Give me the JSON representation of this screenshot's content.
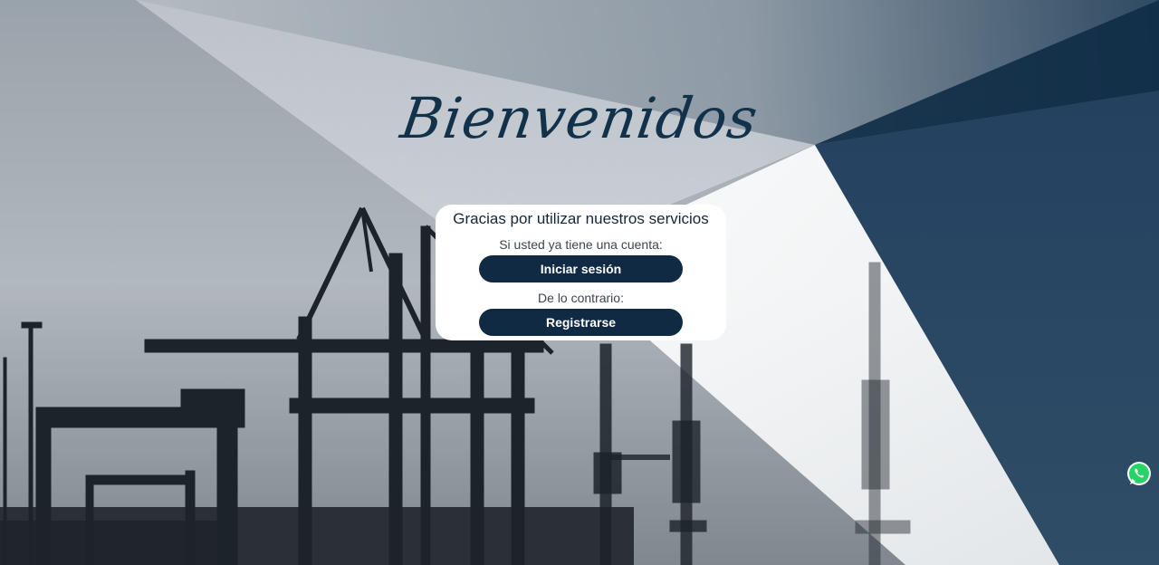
{
  "welcome": {
    "title": "Bienvenidos"
  },
  "card": {
    "heading": "Gracias por utilizar nuestros servicios",
    "login_prompt": "Si usted ya tiene una cuenta:",
    "login_button": "Iniciar sesión",
    "register_prompt": "De lo contrario:",
    "register_button": "Registrarse"
  },
  "floating": {
    "whatsapp_icon": "whatsapp-icon"
  },
  "colors": {
    "brand_dark": "#0f2a42",
    "panel_navy": "#2b4a63",
    "whatsapp_green": "#25d366"
  }
}
